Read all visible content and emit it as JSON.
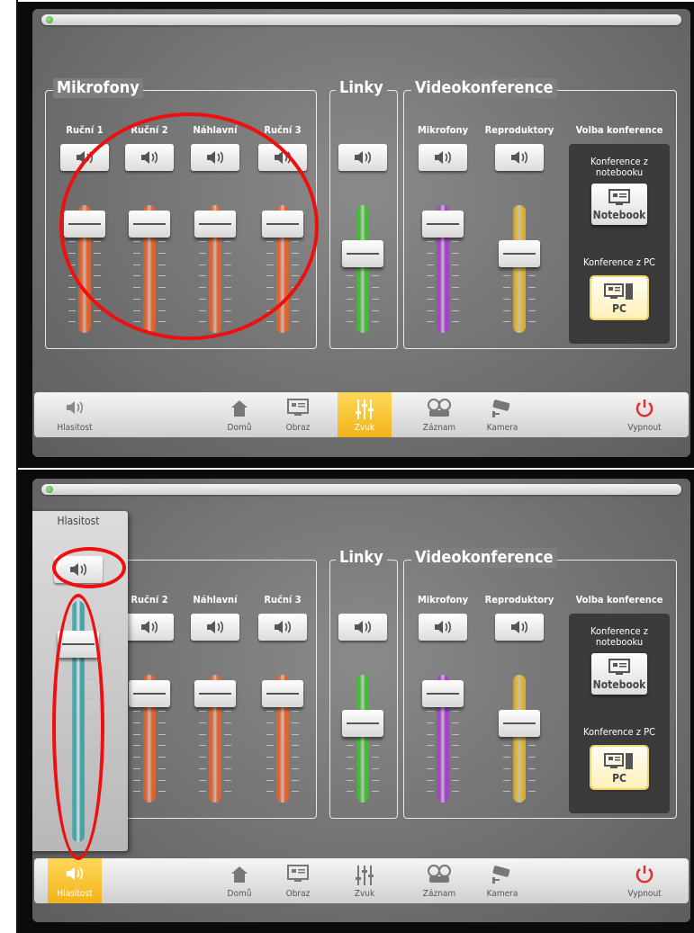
{
  "window": {
    "app": "AV control panel"
  },
  "groups": {
    "mikrofony": "Mikrofony",
    "linky": "Linky",
    "videokonference": "Videokonference"
  },
  "channels": {
    "rucni1": "Ruční 1",
    "rucni2": "Ruční 2",
    "nahlavni": "Náhlavní",
    "rucni3": "Ruční 3",
    "vk_mikrofony": "Mikrofony",
    "vk_reproduktory": "Reproduktory",
    "volba": "Volba konference"
  },
  "conference": {
    "notebook_title": "Konference z notebooku",
    "notebook_button": "Notebook",
    "pc_title": "Konference z PC",
    "pc_button": "PC"
  },
  "nav": {
    "hlasitost": "Hlasitost",
    "domu": "Domů",
    "obraz": "Obraz",
    "zvuk": "Zvuk",
    "zaznam": "Záznam",
    "kamera": "Kamera",
    "vypnout": "Vypnout"
  },
  "popup": {
    "title": "Hlasitost"
  },
  "faders": {
    "rucni1": 0.85,
    "rucni2": 0.85,
    "nahlavni": 0.85,
    "rucni3": 0.85,
    "linky": 0.62,
    "vk_mikrofony": 0.85,
    "vk_reproduktory": 0.62,
    "hlasitost": 0.82
  },
  "colors": {
    "mic": "#e8622a",
    "linky": "#3fbf2f",
    "vk_mic": "#a63fcf",
    "vk_repro": "#e2b62a",
    "hlasitost": "#3a9fa8",
    "accent": "#f5c030",
    "annotation": "#ee1010"
  },
  "state": {
    "panel1_active_tab": "zvuk",
    "panel2_active_tab": "hlasitost",
    "selected_conference": "pc"
  }
}
